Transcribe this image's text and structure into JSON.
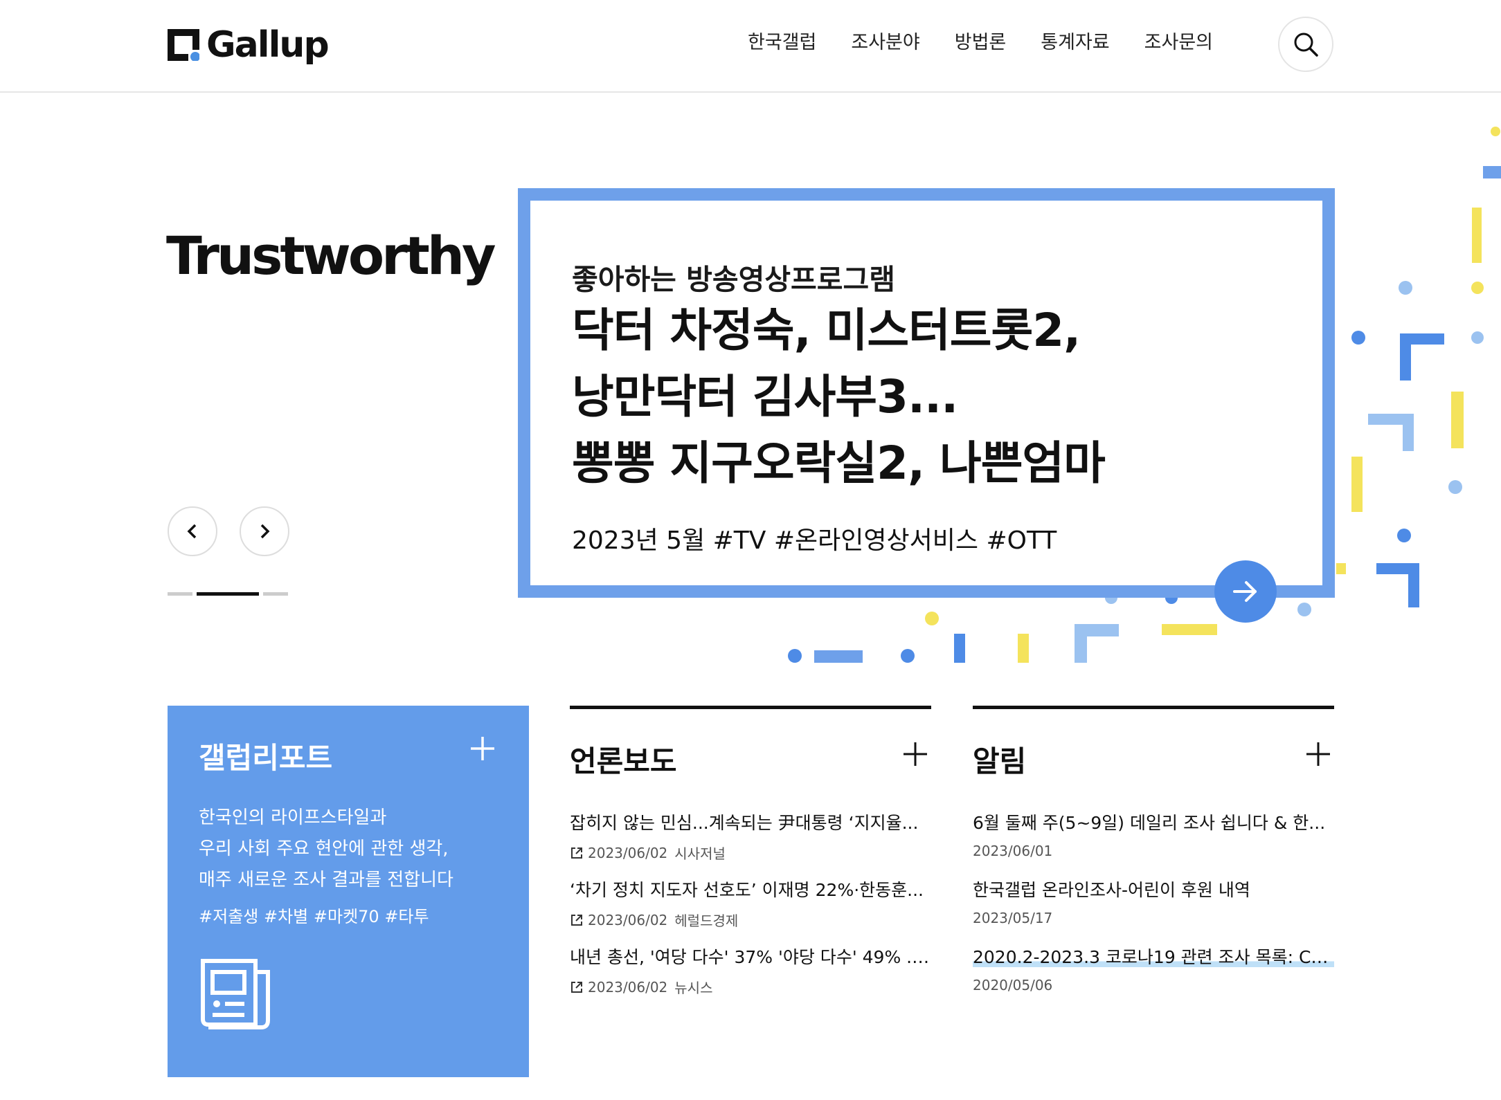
{
  "header": {
    "logo_text": "Gallup",
    "nav": [
      "한국갤럽",
      "조사분야",
      "방법론",
      "통계자료",
      "조사문의"
    ]
  },
  "hero": {
    "tagline": "Trustworthy",
    "feature": {
      "category": "좋아하는 방송영상프로그램",
      "headline_lines": [
        "닥터 차정숙, 미스터트롯2,",
        "낭만닥터 김사부3...",
        "뽕뽕 지구오락실2, 나쁜엄마"
      ],
      "tags": "2023년 5월 #TV #온라인영상서비스 #OTT"
    },
    "slide_indicator": {
      "count": 3,
      "active": 1
    }
  },
  "report_card": {
    "title": "갤럽리포트",
    "desc_lines": [
      "한국인의 라이프스타일과",
      "우리 사회 주요 현안에 관한 생각,",
      "매주 새로운 조사 결과를 전합니다"
    ],
    "tags": "#저출생 #차별 #마켓70 #타투"
  },
  "press": {
    "title": "언론보도",
    "items": [
      {
        "title": "잡히지 않는 민심...계속되는 尹대통령 ‘지지율...",
        "date": "2023/06/02",
        "source": "시사저널"
      },
      {
        "title": "‘차기 정치 지도자 선호도’ 이재명 22%·한동훈...",
        "date": "2023/06/02",
        "source": "헤럴드경제"
      },
      {
        "title": "내년 총선, '여당 다수' 37% '야당 다수' 49% ......",
        "date": "2023/06/02",
        "source": "뉴시스"
      }
    ]
  },
  "notice": {
    "title": "알림",
    "items": [
      {
        "title": "6월 둘째 주(5~9일) 데일리 조사 쉽니다 & 한...",
        "date": "2023/06/01"
      },
      {
        "title": "한국갤럽 온라인조사-어린이 후원 내역",
        "date": "2023/05/17"
      },
      {
        "title": "2020.2-2023.3 코로나19 관련 조사 목록: Co...",
        "date": "2020/05/06"
      }
    ]
  },
  "colors": {
    "accent": "#6ea0ea",
    "card": "#639cea",
    "yellow": "#f4e35c"
  }
}
